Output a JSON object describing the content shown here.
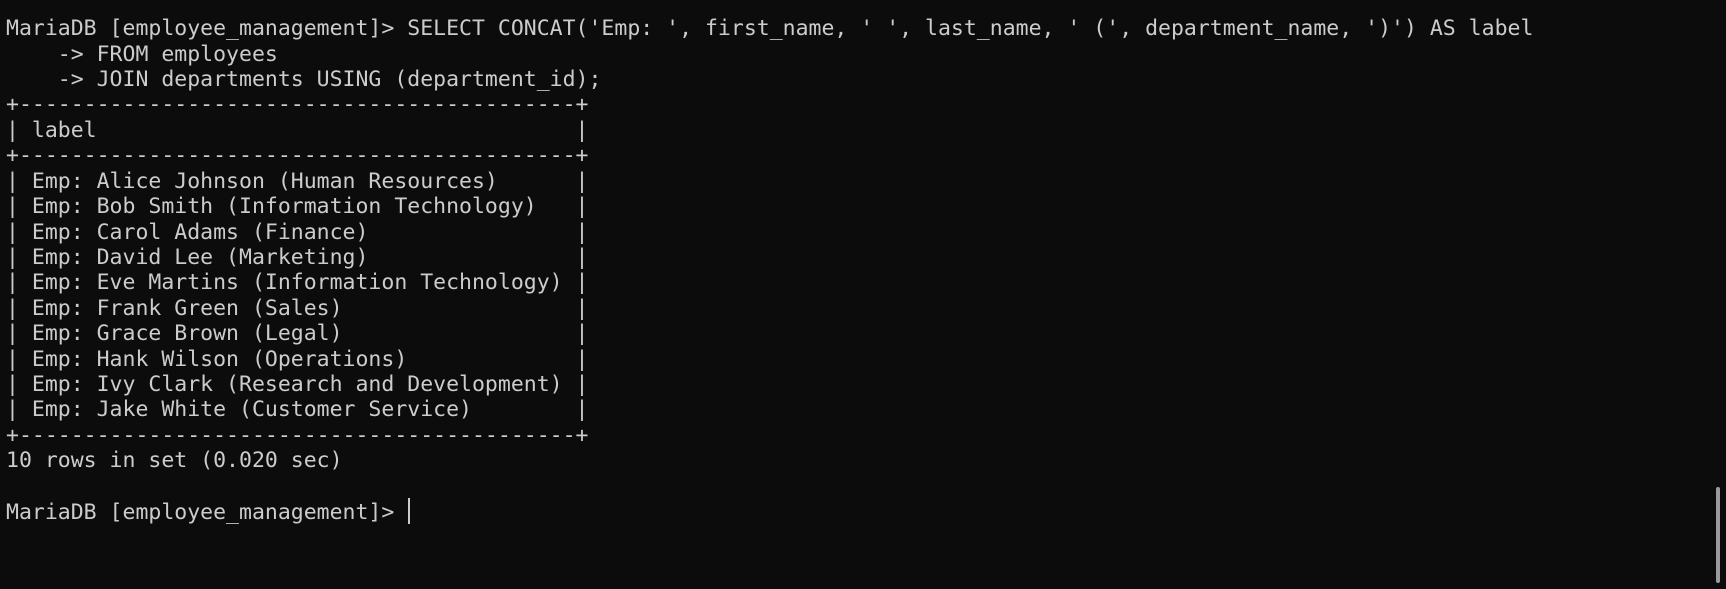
{
  "terminal": {
    "command_lines": [
      "MariaDB [employee_management]> SELECT CONCAT('Emp: ', first_name, ' ', last_name, ' (', department_name, ')') AS label",
      "    -> FROM employees",
      "    -> JOIN departments USING (department_id);"
    ],
    "table_border": "+-------------------------------------------+",
    "table_header": "| label                                     |",
    "table_rows": [
      "| Emp: Alice Johnson (Human Resources)      |",
      "| Emp: Bob Smith (Information Technology)   |",
      "| Emp: Carol Adams (Finance)                |",
      "| Emp: David Lee (Marketing)                |",
      "| Emp: Eve Martins (Information Technology) |",
      "| Emp: Frank Green (Sales)                  |",
      "| Emp: Grace Brown (Legal)                  |",
      "| Emp: Hank Wilson (Operations)             |",
      "| Emp: Ivy Clark (Research and Development) |",
      "| Emp: Jake White (Customer Service)        |"
    ],
    "result_summary": "10 rows in set (0.020 sec)",
    "prompt": "MariaDB [employee_management]> "
  },
  "colors": {
    "background": "#0c0c0c",
    "text": "#cccccc",
    "scrollbar": "#9b9b9b"
  }
}
